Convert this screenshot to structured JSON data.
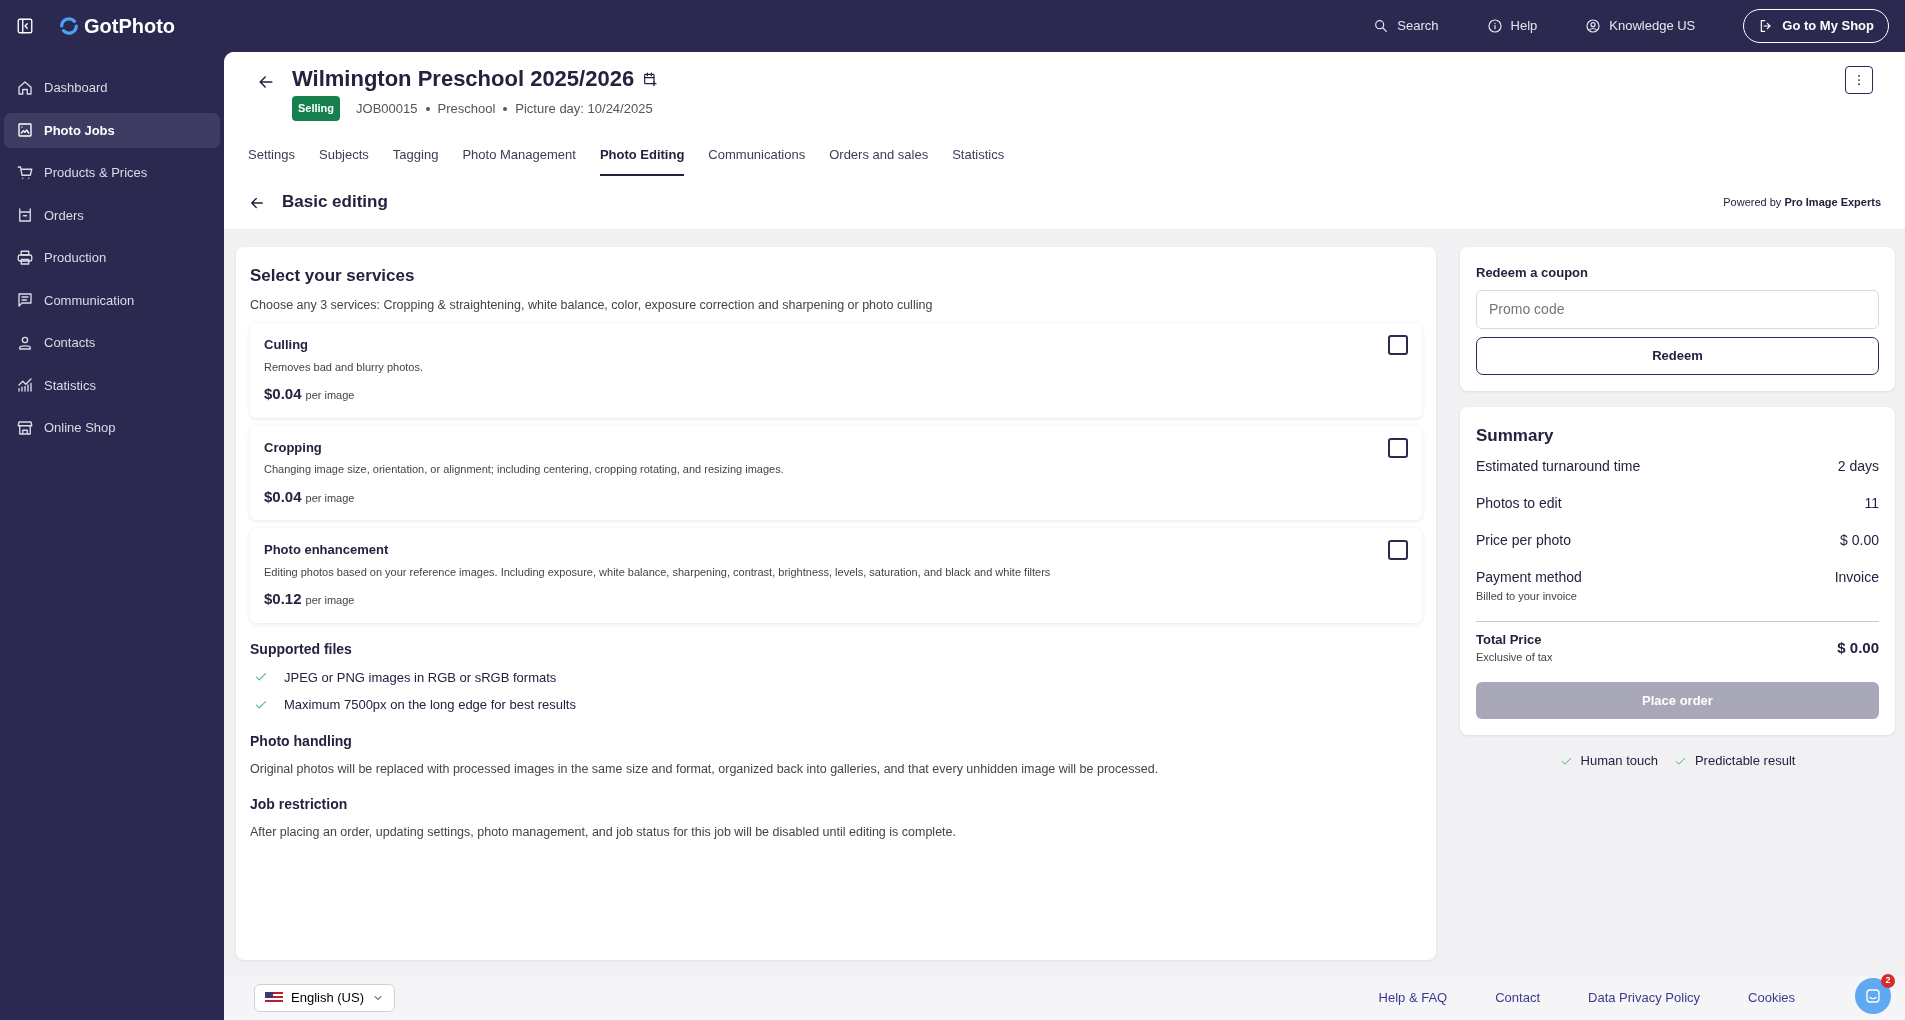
{
  "topbar": {
    "logo": "GotPhoto",
    "search": "Search",
    "help": "Help",
    "account": "Knowledge US",
    "shop_button": "Go to My Shop"
  },
  "sidebar": {
    "items": [
      {
        "label": "Dashboard",
        "selected": false
      },
      {
        "label": "Photo Jobs",
        "selected": true
      },
      {
        "label": "Products & Prices",
        "selected": false
      },
      {
        "label": "Orders",
        "selected": false
      },
      {
        "label": "Production",
        "selected": false
      },
      {
        "label": "Communication",
        "selected": false
      },
      {
        "label": "Contacts",
        "selected": false
      },
      {
        "label": "Statistics",
        "selected": false
      },
      {
        "label": "Online Shop",
        "selected": false
      }
    ]
  },
  "job": {
    "title": "Wilmington Preschool 2025/2026",
    "status": "Selling",
    "job_id": "JOB00015",
    "category": "Preschool",
    "picture_day": "Picture day: 10/24/2025"
  },
  "tabs": [
    {
      "label": "Settings",
      "selected": false
    },
    {
      "label": "Subjects",
      "selected": false
    },
    {
      "label": "Tagging",
      "selected": false
    },
    {
      "label": "Photo Management",
      "selected": false
    },
    {
      "label": "Photo Editing",
      "selected": true
    },
    {
      "label": "Communications",
      "selected": false
    },
    {
      "label": "Orders and sales",
      "selected": false
    },
    {
      "label": "Statistics",
      "selected": false
    }
  ],
  "subheader": {
    "title": "Basic editing",
    "powered_by": "Powered by **Pro Image Experts**"
  },
  "services": {
    "title": "Select your services",
    "subtitle": "Choose any 3 services: Cropping & straightening, white balance, color, exposure correction and sharpening or photo culling",
    "items": [
      {
        "name": "Culling",
        "description": "Removes bad and blurry photos.",
        "price": "$0.04",
        "unit": "per image",
        "checked": false
      },
      {
        "name": "Cropping",
        "description": "Changing image size, orientation, or alignment; including centering, cropping rotating, and resizing images.",
        "price": "$0.04",
        "unit": "per image",
        "checked": false
      },
      {
        "name": "Photo enhancement",
        "description": "Editing photos based on your reference images. Including exposure, white balance, sharpening, contrast, brightness, levels, saturation, and black and white filters",
        "price": "$0.12",
        "unit": "per image",
        "checked": false
      }
    ]
  },
  "supported_files": {
    "title": "Supported files",
    "items": [
      "JPEG or PNG images in RGB or sRGB formats",
      "Maximum 7500px on the long edge for best results"
    ]
  },
  "photo_handling": {
    "title": "Photo handling",
    "text": "Original photos will be replaced with processed images in the same size and format, organized back into galleries, and that every unhidden image will be processed."
  },
  "job_restriction": {
    "title": "Job restriction",
    "text": "After placing an order, updating settings, photo management, and job status for this job will be disabled until editing is complete."
  },
  "coupon": {
    "title": "Redeem a coupon",
    "placeholder": "Promo code",
    "button": "Redeem"
  },
  "summary": {
    "title": "Summary",
    "rows": [
      {
        "label": "Estimated turnaround time",
        "value": "2 days"
      },
      {
        "label": "Photos to edit",
        "value": "11"
      },
      {
        "label": "Price per photo",
        "value": "$ 0.00"
      },
      {
        "label": "Payment method",
        "sublabel": "Billed to your invoice",
        "value": "Invoice"
      }
    ],
    "total": {
      "label": "Total Price",
      "sublabel": "Exclusive of tax",
      "value": "$ 0.00"
    },
    "button": {
      "label": "Place order",
      "disabled": true
    }
  },
  "benefits": [
    "Human touch",
    "Predictable result"
  ],
  "footer": {
    "language": "English (US)",
    "links": [
      "Help & FAQ",
      "Contact",
      "Data Privacy Policy",
      "Cookies"
    ]
  },
  "chat": {
    "badge": "2"
  }
}
